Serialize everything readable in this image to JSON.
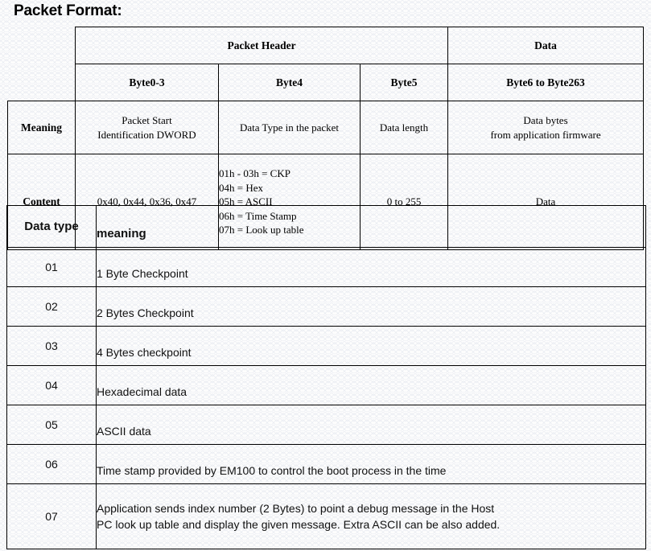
{
  "title": "Packet Format:",
  "packet_format_table": {
    "group_headers": [
      {
        "label": "",
        "span": 1
      },
      {
        "label": "Packet Header",
        "span": 3
      },
      {
        "label": "Data",
        "span": 1
      }
    ],
    "byte_headers": [
      "",
      "Byte0-3",
      "Byte4",
      "Byte5",
      "Byte6 to Byte263"
    ],
    "rows": [
      {
        "label": "Meaning",
        "cells": [
          {
            "lines": [
              "Packet Start",
              "Identification DWORD"
            ],
            "align": "center"
          },
          {
            "lines": [
              "Data Type in the packet"
            ],
            "align": "center"
          },
          {
            "lines": [
              "Data length"
            ],
            "align": "center"
          },
          {
            "lines": [
              "Data bytes",
              "from application firmware"
            ],
            "align": "center"
          }
        ]
      },
      {
        "label": "Content",
        "cells": [
          {
            "lines": [
              "0x40, 0x44, 0x36, 0x47"
            ],
            "align": "center"
          },
          {
            "lines": [
              "01h - 03h = CKP",
              "04h = Hex",
              "05h = ASCII",
              "06h = Time Stamp",
              "07h = Look up table"
            ],
            "align": "left"
          },
          {
            "lines": [
              "0 to 255"
            ],
            "align": "center"
          },
          {
            "lines": [
              "Data"
            ],
            "align": "center"
          }
        ]
      }
    ]
  },
  "data_type_table": {
    "headers": {
      "type": "Data type",
      "meaning": "meaning"
    },
    "rows": [
      {
        "type": "01",
        "meaning_lines": [
          "1 Byte Checkpoint"
        ]
      },
      {
        "type": "02",
        "meaning_lines": [
          "2 Bytes Checkpoint"
        ]
      },
      {
        "type": "03",
        "meaning_lines": [
          "4 Bytes checkpoint"
        ]
      },
      {
        "type": "04",
        "meaning_lines": [
          "Hexadecimal data"
        ]
      },
      {
        "type": "05",
        "meaning_lines": [
          "ASCII data"
        ]
      },
      {
        "type": "06",
        "meaning_lines": [
          "Time stamp provided by EM100 to control the boot process in the time"
        ]
      },
      {
        "type": "07",
        "meaning_lines": [
          "Application sends index number (2 Bytes) to point a debug message in the Host",
          "PC look up table and display the given message. Extra ASCII can be also added."
        ]
      }
    ]
  }
}
